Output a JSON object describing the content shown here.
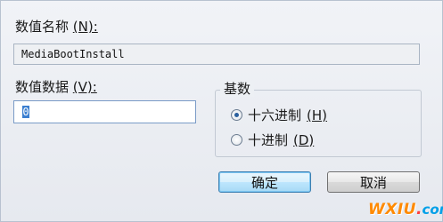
{
  "dialog": {
    "value_name_label": "数值名称",
    "value_name_key": "(N):",
    "value_name": "MediaBootInstall",
    "value_data_label": "数值数据",
    "value_data_key": "(V):",
    "value_data": "0",
    "base_group": {
      "title": "基数",
      "options": [
        {
          "label": "十六进制",
          "key": "(H)",
          "checked": true
        },
        {
          "label": "十进制",
          "key": "(D)",
          "checked": false
        }
      ]
    },
    "ok_label": "确定",
    "cancel_label": "取消"
  },
  "watermark": {
    "main": "WXIU",
    "dot": ".",
    "suffix": "com"
  },
  "colors": {
    "accent": "#3c7fb1",
    "watermark_orange": "#ff8a00",
    "watermark_blue": "#00a0e8"
  }
}
